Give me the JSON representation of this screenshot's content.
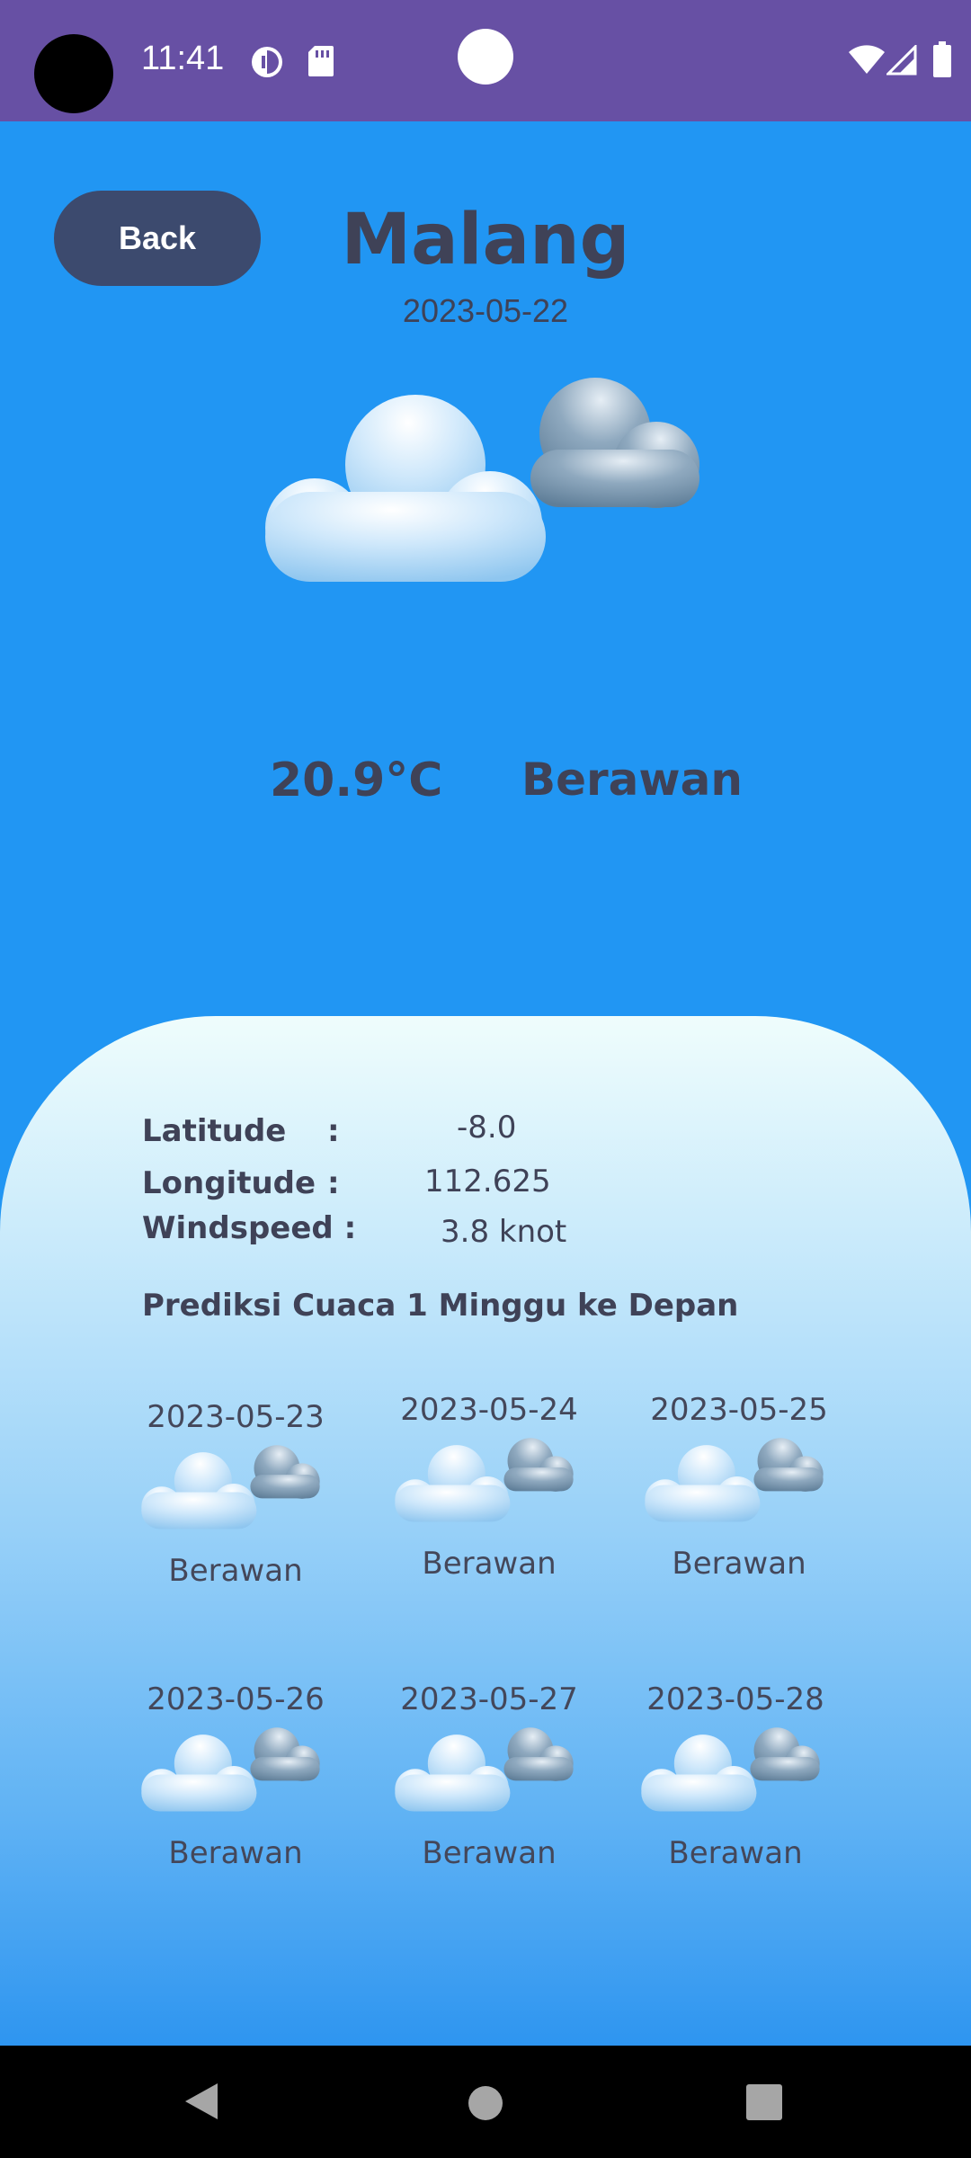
{
  "status_bar": {
    "time": "11:41"
  },
  "header": {
    "back_label": "Back",
    "city": "Malang",
    "date": "2023-05-22"
  },
  "current": {
    "temperature": "20.9°C",
    "condition": "Berawan"
  },
  "details": {
    "latitude_label": "Latitude",
    "latitude_value": "-8.0",
    "longitude_label": "Longitude",
    "longitude_value": "112.625",
    "windspeed_label": "Windspeed :",
    "windspeed_value": "3.8 knot",
    "colon": ":"
  },
  "forecast": {
    "heading": "Prediksi Cuaca 1 Minggu ke Depan",
    "days": [
      {
        "date": "2023-05-23",
        "condition": "Berawan"
      },
      {
        "date": "2023-05-24",
        "condition": "Berawan"
      },
      {
        "date": "2023-05-25",
        "condition": "Berawan"
      },
      {
        "date": "2023-05-26",
        "condition": "Berawan"
      },
      {
        "date": "2023-05-27",
        "condition": "Berawan"
      },
      {
        "date": "2023-05-28",
        "condition": "Berawan"
      }
    ]
  },
  "icons": {
    "weather": "cloud-icon",
    "status": [
      "data-saver-icon",
      "sd-card-icon",
      "wifi-icon",
      "signal-icon",
      "battery-icon"
    ],
    "nav": [
      "back-triangle-icon",
      "home-circle-icon",
      "recents-square-icon"
    ]
  },
  "colors": {
    "status_bar": "#6750A4",
    "background": "#2196F3",
    "back_button": "#3c4a6e",
    "text": "#3f4257"
  }
}
